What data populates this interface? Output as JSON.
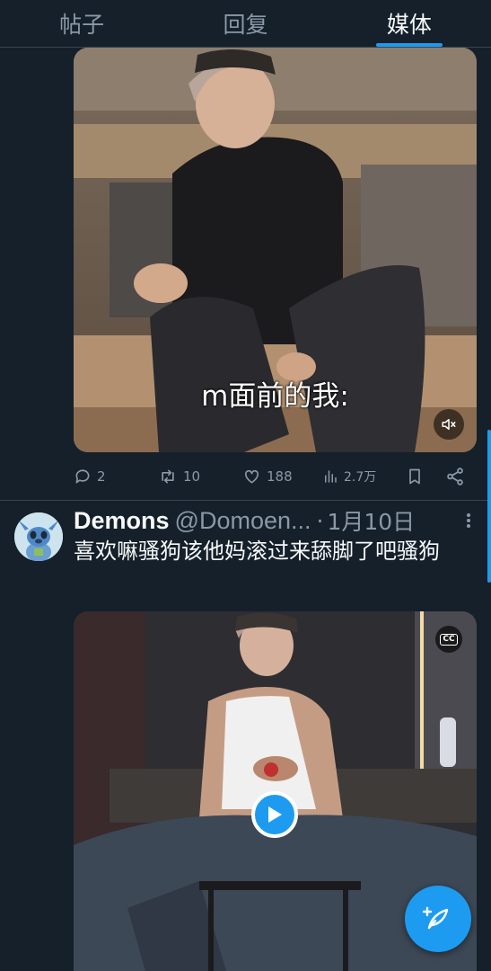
{
  "tabs": [
    {
      "label": "帖子",
      "active": false
    },
    {
      "label": "回复",
      "active": false
    },
    {
      "label": "媒体",
      "active": true
    }
  ],
  "post1": {
    "media": {
      "subtitle": "m面前的我:",
      "mute_icon": "volume-mute-icon"
    },
    "actions": {
      "replies": "2",
      "retweets": "10",
      "likes": "188",
      "views": "2.7万"
    }
  },
  "post2": {
    "author_name": "Demons",
    "author_handle": "@Domoen...",
    "separator": "·",
    "date": "1月10日",
    "text": "喜欢嘛骚狗该他妈滚过来舔脚了吧骚狗",
    "media": {
      "cc_label": "CC",
      "play_icon": "play-icon"
    }
  },
  "fab": {
    "icon": "compose-feather-icon"
  },
  "colors": {
    "background": "#15202b",
    "accent": "#1d9bf0",
    "muted_text": "#8b98a5",
    "divider": "#38444d"
  }
}
